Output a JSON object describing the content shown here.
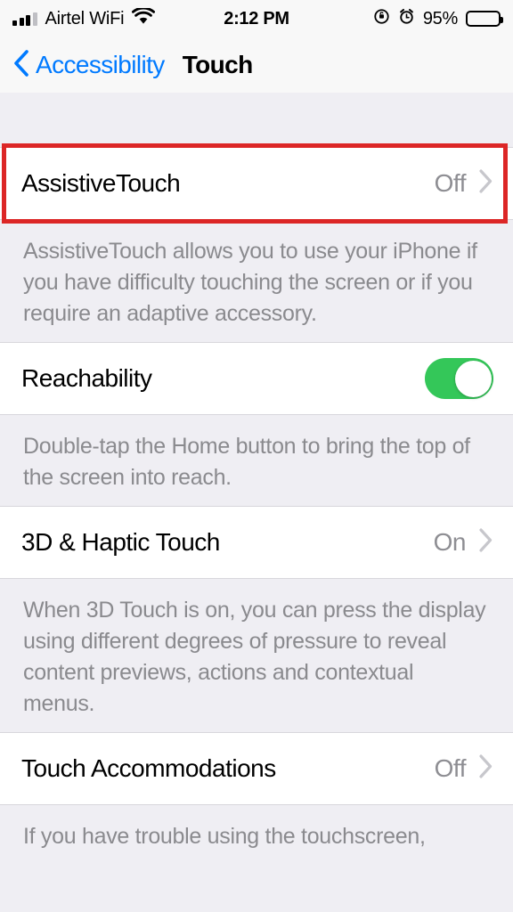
{
  "status_bar": {
    "carrier": "Airtel WiFi",
    "signal_icon": "cellular-signal-icon",
    "signal_bars_filled": 3,
    "signal_bars_total": 4,
    "wifi_icon": "wifi-icon",
    "time": "2:12 PM",
    "rotation_lock_icon": "rotation-lock-icon",
    "alarm_icon": "alarm-clock-icon",
    "battery_percent": "95%",
    "battery_icon": "battery-icon"
  },
  "nav": {
    "back_icon": "chevron-left-icon",
    "back_label": "Accessibility",
    "title": "Touch"
  },
  "sections": [
    {
      "row": {
        "label": "AssistiveTouch",
        "value": "Off",
        "type": "disclosure",
        "chevron_icon": "chevron-right-icon",
        "highlighted": true
      },
      "footer": "AssistiveTouch allows you to use your iPhone if you have difficulty touching the screen or if you require an adaptive accessory."
    },
    {
      "row": {
        "label": "Reachability",
        "value": "",
        "type": "toggle",
        "toggle_on": true
      },
      "footer": "Double-tap the Home button to bring the top of the screen into reach."
    },
    {
      "row": {
        "label": "3D & Haptic Touch",
        "value": "On",
        "type": "disclosure",
        "chevron_icon": "chevron-right-icon",
        "highlighted": false
      },
      "footer": "When 3D Touch is on, you can press the display using different degrees of pressure to reveal content previews, actions and contextual menus."
    },
    {
      "row": {
        "label": "Touch Accommodations",
        "value": "Off",
        "type": "disclosure",
        "chevron_icon": "chevron-right-icon",
        "highlighted": false
      },
      "footer": "If you have trouble using the touchscreen,"
    }
  ],
  "colors": {
    "accent_blue": "#007AFF",
    "toggle_green": "#34C759",
    "highlight_red": "#DC2626",
    "secondary_text": "#8E8E93",
    "group_background": "#EFEEF3",
    "row_background": "#FFFFFF"
  }
}
